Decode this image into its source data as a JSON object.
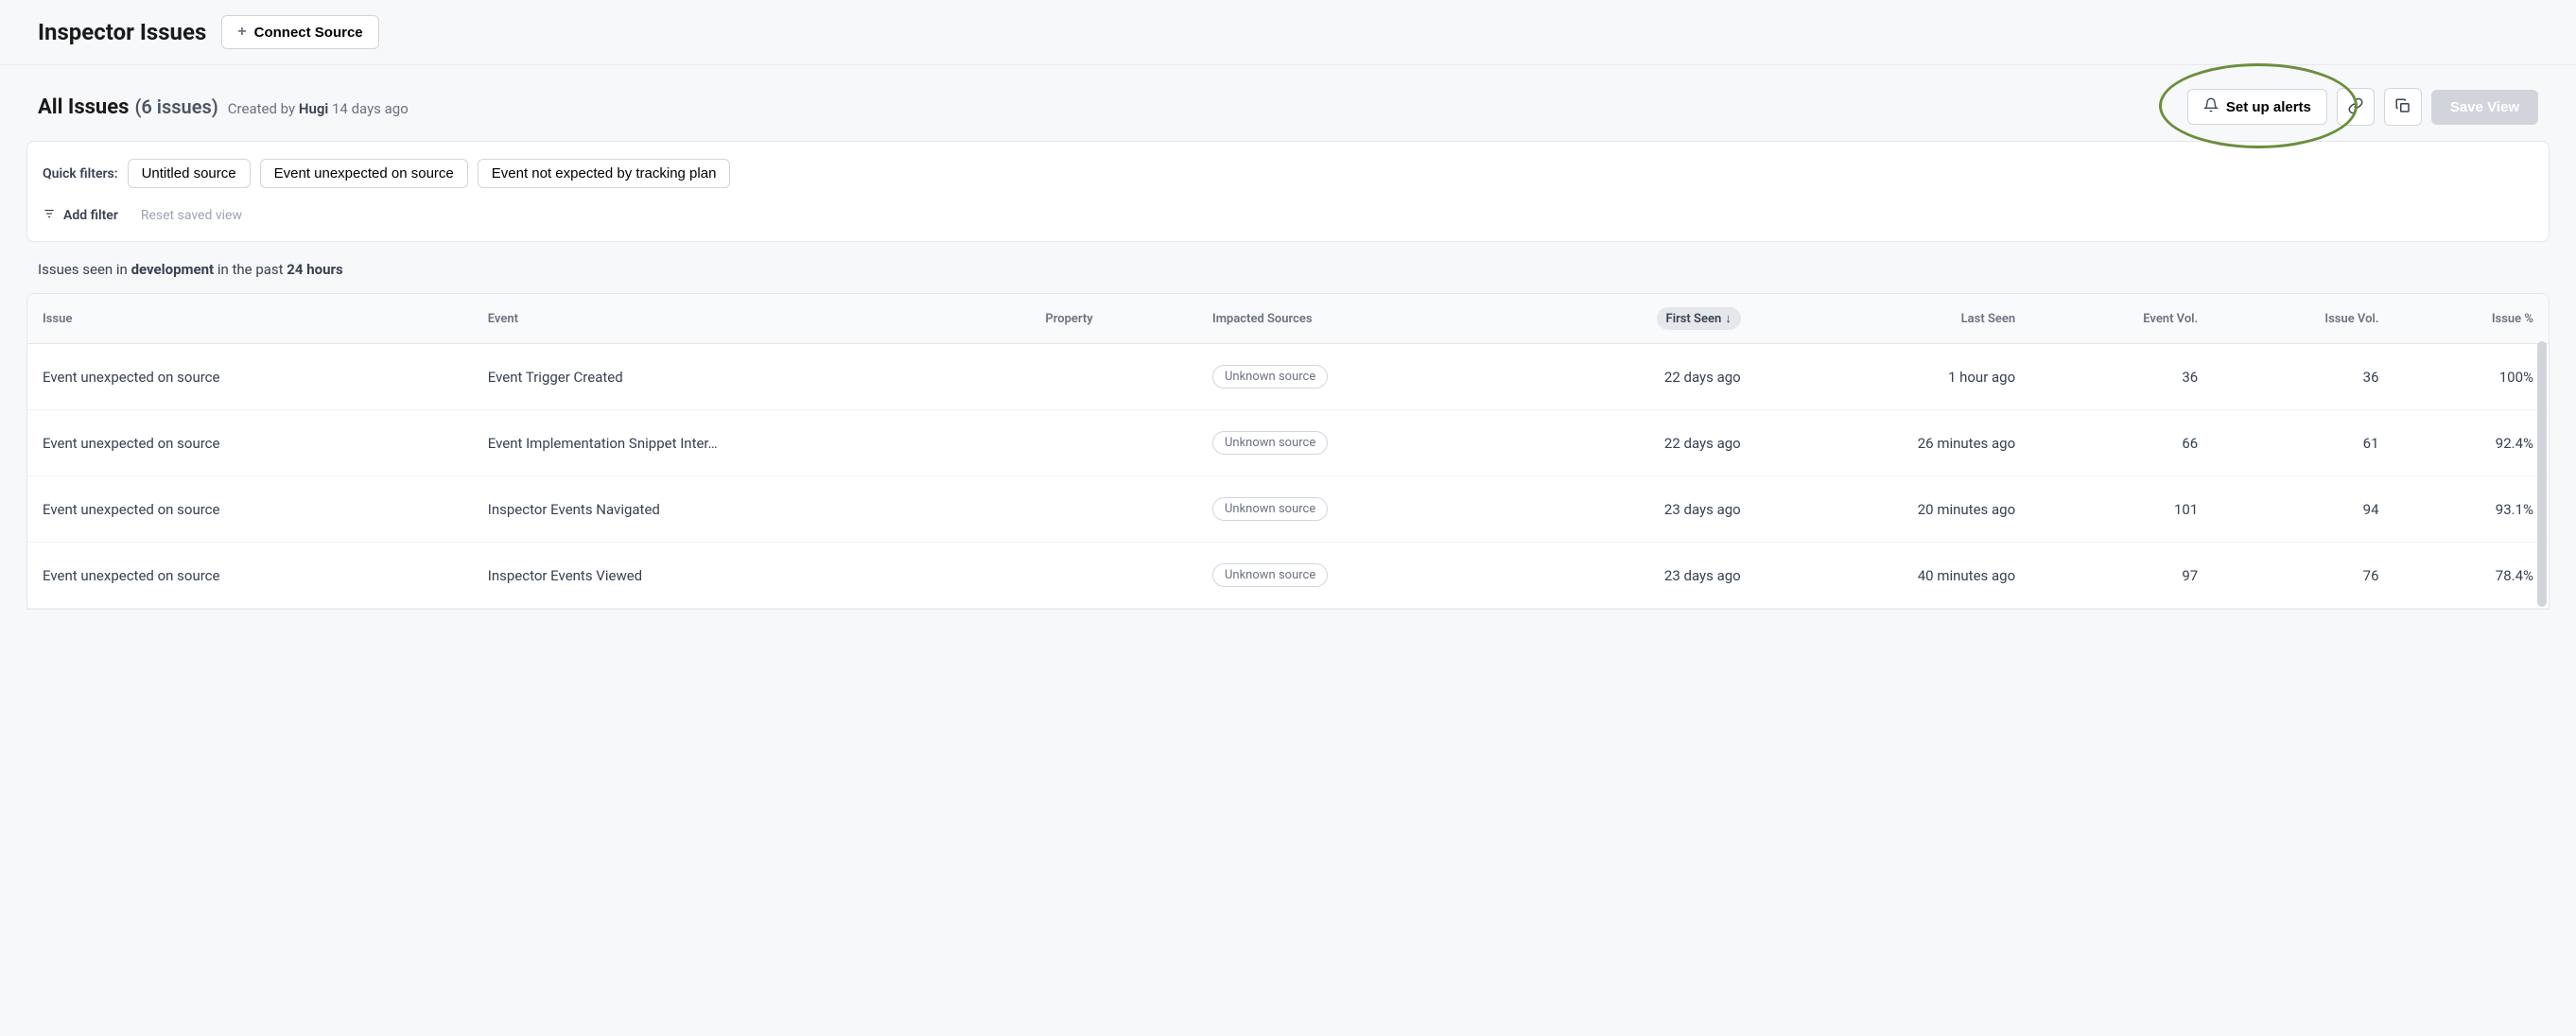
{
  "header": {
    "title": "Inspector Issues",
    "connect_label": "Connect Source"
  },
  "subheader": {
    "title": "All Issues",
    "count_label": "(6 issues)",
    "created_prefix": "Created by",
    "created_by": "Hugi",
    "created_ago": "14 days ago",
    "alerts_label": "Set up alerts",
    "save_view_label": "Save View"
  },
  "filters": {
    "label": "Quick filters:",
    "chips": [
      "Untitled source",
      "Event unexpected on source",
      "Event not expected by tracking plan"
    ],
    "add_filter_label": "Add filter",
    "reset_label": "Reset saved view"
  },
  "summary": {
    "prefix": "Issues seen in",
    "env": "development",
    "mid": "in the past",
    "range": "24 hours"
  },
  "table": {
    "columns": {
      "issue": "Issue",
      "event": "Event",
      "property": "Property",
      "sources": "Impacted Sources",
      "first_seen": "First Seen",
      "last_seen": "Last Seen",
      "event_vol": "Event Vol.",
      "issue_vol": "Issue Vol.",
      "issue_pct": "Issue %"
    },
    "rows": [
      {
        "issue": "Event unexpected on source",
        "event": "Event Trigger Created",
        "property": "",
        "source": "Unknown source",
        "first_seen": "22 days ago",
        "last_seen": "1 hour ago",
        "event_vol": "36",
        "issue_vol": "36",
        "issue_pct": "100%"
      },
      {
        "issue": "Event unexpected on source",
        "event": "Event Implementation Snippet Inter…",
        "property": "",
        "source": "Unknown source",
        "first_seen": "22 days ago",
        "last_seen": "26 minutes ago",
        "event_vol": "66",
        "issue_vol": "61",
        "issue_pct": "92.4%"
      },
      {
        "issue": "Event unexpected on source",
        "event": "Inspector Events Navigated",
        "property": "",
        "source": "Unknown source",
        "first_seen": "23 days ago",
        "last_seen": "20 minutes ago",
        "event_vol": "101",
        "issue_vol": "94",
        "issue_pct": "93.1%"
      },
      {
        "issue": "Event unexpected on source",
        "event": "Inspector Events Viewed",
        "property": "",
        "source": "Unknown source",
        "first_seen": "23 days ago",
        "last_seen": "40 minutes ago",
        "event_vol": "97",
        "issue_vol": "76",
        "issue_pct": "78.4%"
      }
    ]
  }
}
